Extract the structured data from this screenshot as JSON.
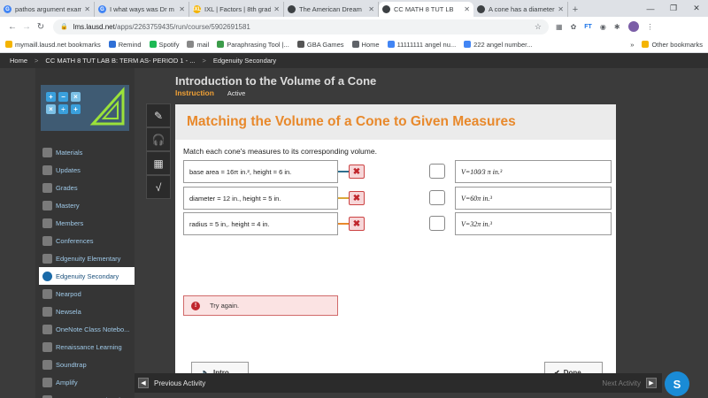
{
  "browser": {
    "tabs": [
      {
        "title": "pathos argument exam",
        "color": "#4285f4",
        "glyph": "G",
        "active": false
      },
      {
        "title": "I what ways was Dr m",
        "color": "#4285f4",
        "glyph": "G",
        "active": false
      },
      {
        "title": "IXL | Factors | 8th grad",
        "color": "#f4b400",
        "glyph": "IXL",
        "active": false
      },
      {
        "title": "The American Dream",
        "color": "#3c4043",
        "glyph": "",
        "active": false
      },
      {
        "title": "CC MATH 8 TUT LB",
        "color": "#3c4043",
        "glyph": "",
        "active": true
      },
      {
        "title": "A cone has a diameter",
        "color": "#3c4043",
        "glyph": "",
        "active": false
      }
    ],
    "new_tab": "+",
    "url_host": "lms.lausd.net",
    "url_path": "/apps/2263759435/run/course/5902691581",
    "ext_ft": "FT",
    "bookmarks": [
      {
        "label": "mymaill.lausd.net bookmarks",
        "color": "#f4b400"
      },
      {
        "label": "Remind",
        "color": "#2e6fd6"
      },
      {
        "label": "Spotify",
        "color": "#1db954"
      },
      {
        "label": "mail",
        "color": "#888888"
      },
      {
        "label": "Paraphrasing Tool |...",
        "color": "#3c9c4a"
      },
      {
        "label": "GBA Games",
        "color": "#555555"
      },
      {
        "label": "Home",
        "color": "#5f6368"
      },
      {
        "label": "11111111 angel nu...",
        "color": "#4285f4"
      },
      {
        "label": "222 angel number...",
        "color": "#4285f4"
      }
    ],
    "bookmarks_overflow": "»",
    "other_bookmarks": "Other bookmarks"
  },
  "edgnav": {
    "home": "Home",
    "course": "CC MATH 8 TUT LAB B: TERM AS- PERIOD 1 - ...",
    "current": "Edgenuity Secondary",
    "sep": ">"
  },
  "sidebar": {
    "items": [
      {
        "label": "Materials"
      },
      {
        "label": "Updates"
      },
      {
        "label": "Grades"
      },
      {
        "label": "Mastery"
      },
      {
        "label": "Members"
      },
      {
        "label": "Conferences"
      },
      {
        "label": "Edgenuity Elementary"
      },
      {
        "label": "Edgenuity Secondary"
      },
      {
        "label": "Nearpod"
      },
      {
        "label": "Newsela"
      },
      {
        "label": "OneNote Class Notebo..."
      },
      {
        "label": "Renaissance Learning"
      },
      {
        "label": "Soundtrap"
      },
      {
        "label": "Amplify"
      },
      {
        "label": "Tutor.com-CoA Virtual"
      }
    ]
  },
  "lesson": {
    "title": "Introduction to the Volume of a Cone",
    "section": "Instruction",
    "status": "Active"
  },
  "activity": {
    "heading": "Matching the Volume of a Cone to Given Measures",
    "prompt": "Match each cone's measures to its corresponding volume.",
    "measures": [
      {
        "label": "base area = 16π in.², height = 6 in.",
        "connector": "#2e6f8e"
      },
      {
        "label": "diameter = 12 in., height = 5 in.",
        "connector": "#d9a83a"
      },
      {
        "label": "radius = 5 in,. height = 4 in.",
        "connector": "#e8892c"
      }
    ],
    "volumes": [
      {
        "label": "V=100⁄3 π in.³"
      },
      {
        "label": "V=60π in.³"
      },
      {
        "label": "V=32π in.³"
      }
    ],
    "alert": "Try again.",
    "intro_button": "Intro",
    "done_button": "Done"
  },
  "bottombar": {
    "previous": "Previous Activity",
    "next": "Next Activity"
  },
  "fab_letter": "S"
}
